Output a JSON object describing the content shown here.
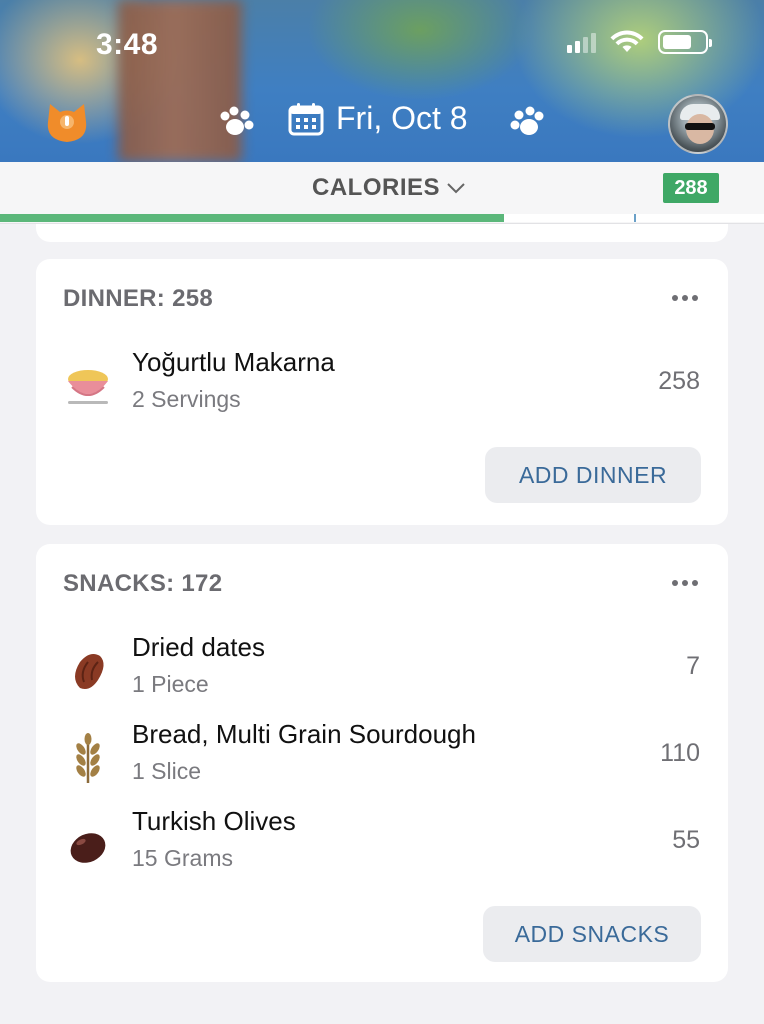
{
  "status_bar": {
    "time": "3:48"
  },
  "header": {
    "date": "Fri, Oct 8",
    "icons": {
      "logo": "cat-logo-icon",
      "prev": "paw-left-icon",
      "calendar": "calendar-icon",
      "next": "paw-right-icon"
    }
  },
  "subbar": {
    "metric_label": "CALORIES",
    "remaining": "288",
    "progress": 0.66,
    "colors": {
      "progress": "#5bb77a",
      "badge": "#3fa866"
    }
  },
  "meals": {
    "dinner": {
      "title": "DINNER: 258",
      "items": [
        {
          "name": "Yoğurtlu Makarna",
          "serving": "2 Servings",
          "calories": "258",
          "icon": "pasta-bowl-icon"
        }
      ],
      "add_label": "ADD DINNER"
    },
    "snacks": {
      "title": "SNACKS: 172",
      "items": [
        {
          "name": "Dried dates",
          "serving": "1 Piece",
          "calories": "7",
          "icon": "date-fruit-icon"
        },
        {
          "name": "Bread, Multi Grain Sourdough",
          "serving": "1 Slice",
          "calories": "110",
          "icon": "wheat-icon"
        },
        {
          "name": "Turkish Olives",
          "serving": "15 Grams",
          "calories": "55",
          "icon": "olive-icon"
        }
      ],
      "add_label": "ADD SNACKS"
    }
  }
}
